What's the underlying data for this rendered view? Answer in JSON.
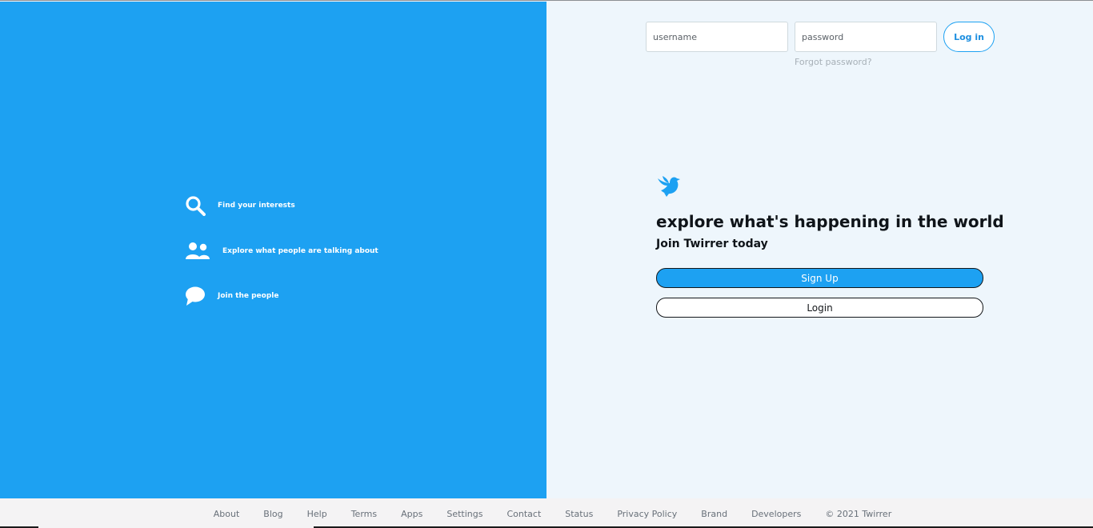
{
  "left_panel": {
    "features": [
      {
        "icon": "search-icon",
        "label": "Find your interests"
      },
      {
        "icon": "people-icon",
        "label": "Explore what people are talking about"
      },
      {
        "icon": "chat-bubble-icon",
        "label": "Join the people"
      }
    ]
  },
  "login_form": {
    "username_placeholder": "username",
    "password_placeholder": "password",
    "login_button": "Log in",
    "forgot_password": "Forgot password?"
  },
  "cta": {
    "logo_icon": "bird-icon",
    "headline": "explore what's happening in the world",
    "subhead": "Join Twirrer today",
    "signup_button": "Sign Up",
    "login_button": "Login"
  },
  "footer": {
    "links": [
      "About",
      "Blog",
      "Help",
      "Terms",
      "Apps",
      "Settings",
      "Contact",
      "Status",
      "Privacy Policy",
      "Brand",
      "Developers"
    ],
    "copyright": "© 2021 Twirrer"
  },
  "colors": {
    "brand_blue": "#1da1f2",
    "right_background": "#eef6fc",
    "footer_background": "#f4f3f4"
  }
}
